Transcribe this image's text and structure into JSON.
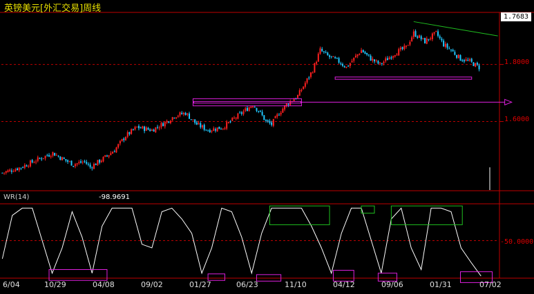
{
  "header": {
    "title": "英镑美元[外汇交易]周线",
    "last_price": "1.7683"
  },
  "indicator": {
    "name": "WR(14)",
    "value": "-98.9691"
  },
  "colors": {
    "up": "#ff2020",
    "down": "#20c8ff",
    "wr_line": "#ffffff",
    "frame": "#c00000",
    "magenta": "#e020e0",
    "green": "#20c020"
  },
  "chart_data": [
    {
      "type": "candlestick",
      "title": "英镑美元[外汇交易]周线",
      "ylim": [
        1.36,
        1.98
      ],
      "yticks": [
        "1.8000",
        "1.6000"
      ],
      "x_tick_labels": [
        "6/04",
        "10/29",
        "04/08",
        "09/02",
        "01/27",
        "06/23",
        "11/10",
        "04/12",
        "09/06",
        "01/31",
        "07/02"
      ],
      "close_path": [
        [
          0,
          1.42
        ],
        [
          10,
          1.44
        ],
        [
          20,
          1.47
        ],
        [
          27,
          1.49
        ],
        [
          32,
          1.47
        ],
        [
          38,
          1.45
        ],
        [
          44,
          1.46
        ],
        [
          47,
          1.44
        ],
        [
          54,
          1.47
        ],
        [
          60,
          1.5
        ],
        [
          66,
          1.55
        ],
        [
          72,
          1.58
        ],
        [
          80,
          1.57
        ],
        [
          88,
          1.6
        ],
        [
          92,
          1.62
        ],
        [
          98,
          1.63
        ],
        [
          104,
          1.59
        ],
        [
          110,
          1.57
        ],
        [
          118,
          1.58
        ],
        [
          124,
          1.61
        ],
        [
          128,
          1.63
        ],
        [
          134,
          1.66
        ],
        [
          138,
          1.63
        ],
        [
          141,
          1.6
        ],
        [
          144,
          1.59
        ],
        [
          148,
          1.63
        ],
        [
          152,
          1.66
        ],
        [
          158,
          1.69
        ],
        [
          166,
          1.78
        ],
        [
          170,
          1.85
        ],
        [
          174,
          1.83
        ],
        [
          180,
          1.81
        ],
        [
          184,
          1.79
        ],
        [
          188,
          1.82
        ],
        [
          192,
          1.85
        ],
        [
          197,
          1.82
        ],
        [
          202,
          1.8
        ],
        [
          210,
          1.84
        ],
        [
          216,
          1.86
        ],
        [
          220,
          1.91
        ],
        [
          226,
          1.88
        ],
        [
          232,
          1.91
        ],
        [
          236,
          1.87
        ],
        [
          240,
          1.85
        ],
        [
          245,
          1.82
        ],
        [
          250,
          1.81
        ],
        [
          255,
          1.79
        ]
      ],
      "annotations": {
        "trendline_start": [
          220,
          1.95
        ],
        "trendline_end": [
          265,
          1.9
        ],
        "support_box": [
          178,
          251,
          1.748,
          1.756
        ],
        "mid_box": [
          102,
          160,
          1.655,
          1.68
        ],
        "arrow": [
          160,
          265,
          1.668
        ]
      }
    },
    {
      "type": "line",
      "title": "WR(14)",
      "ylim": [
        -100,
        0
      ],
      "yticks": [
        "-50.0000"
      ],
      "values": [
        -75,
        -15,
        -5,
        -5,
        -50,
        -95,
        -60,
        -10,
        -45,
        -95,
        -30,
        -5,
        -5,
        -5,
        -55,
        -60,
        -10,
        -5,
        -20,
        -40,
        -95,
        -60,
        -5,
        -10,
        -45,
        -95,
        -40,
        -5,
        -5,
        -5,
        -5,
        -30,
        -60,
        -95,
        -40,
        -5,
        -5,
        -50,
        -95,
        -20,
        -5,
        -60,
        -90,
        -5,
        -5,
        -10,
        -60,
        -80,
        -99
      ],
      "green_boxes": [
        [
          143,
          175,
          -2,
          -28
        ],
        [
          192,
          199,
          -2,
          -12
        ],
        [
          208,
          246,
          -2,
          -28
        ]
      ],
      "magenta_boxes": [
        [
          25,
          56,
          -90,
          -105
        ],
        [
          110,
          119,
          -96,
          -105
        ],
        [
          136,
          149,
          -97,
          -106
        ],
        [
          177,
          188,
          -91,
          -106
        ],
        [
          201,
          211,
          -95,
          -106
        ],
        [
          245,
          262,
          -93,
          -108
        ]
      ]
    }
  ]
}
